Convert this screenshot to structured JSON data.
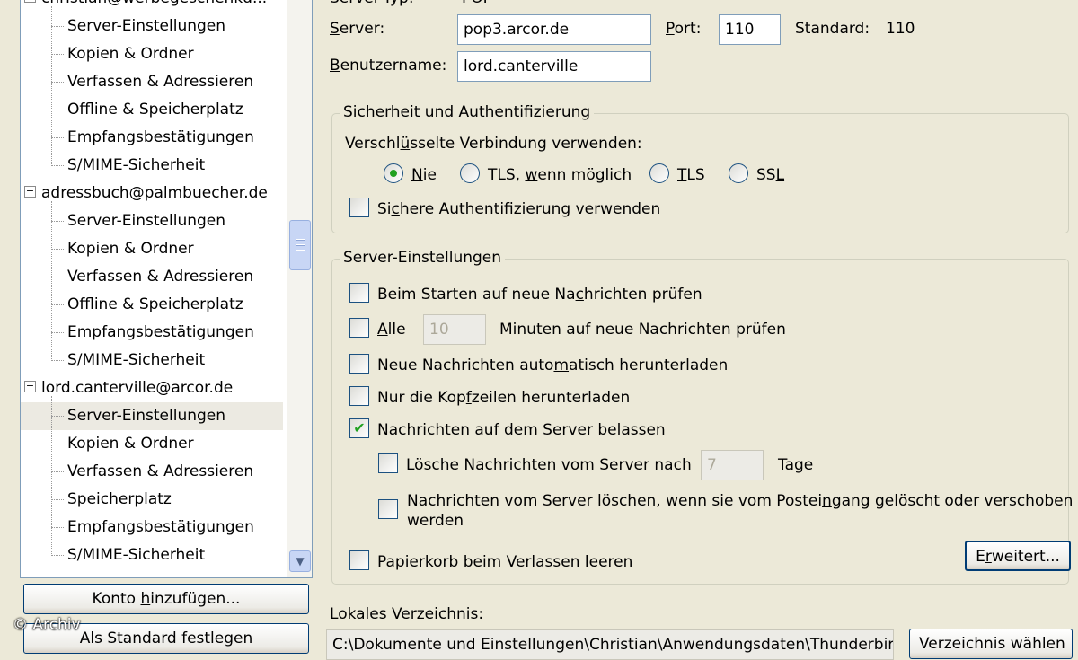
{
  "tree": {
    "items": [
      {
        "label": "christian@werbegeschenkd...",
        "level": 0
      },
      {
        "label": "Server-Einstellungen",
        "level": 1
      },
      {
        "label": "Kopien & Ordner",
        "level": 1
      },
      {
        "label": "Verfassen & Adressieren",
        "level": 1
      },
      {
        "label": "Offline & Speicherplatz",
        "level": 1
      },
      {
        "label": "Empfangsbestätigungen",
        "level": 1
      },
      {
        "label": "S/MIME-Sicherheit",
        "level": 1
      },
      {
        "label": "adressbuch@palmbuecher.de",
        "level": 0
      },
      {
        "label": "Server-Einstellungen",
        "level": 1
      },
      {
        "label": "Kopien & Ordner",
        "level": 1
      },
      {
        "label": "Verfassen & Adressieren",
        "level": 1
      },
      {
        "label": "Offline & Speicherplatz",
        "level": 1
      },
      {
        "label": "Empfangsbestätigungen",
        "level": 1
      },
      {
        "label": "S/MIME-Sicherheit",
        "level": 1
      },
      {
        "label": "lord.canterville@arcor.de",
        "level": 0
      },
      {
        "label": "Server-Einstellungen",
        "level": 1,
        "selected": true
      },
      {
        "label": "Kopien & Ordner",
        "level": 1
      },
      {
        "label": "Verfassen & Adressieren",
        "level": 1
      },
      {
        "label": "Speicherplatz",
        "level": 1
      },
      {
        "label": "Empfangsbestätigungen",
        "level": 1
      },
      {
        "label": "S/MIME-Sicherheit",
        "level": 1
      }
    ],
    "collapse_glyph": "−"
  },
  "buttons": {
    "add_account": {
      "before": "Konto ",
      "key": "h",
      "after": "inzufügen..."
    },
    "set_default": "Als Standard festlegen",
    "advanced": {
      "before": "E",
      "key": "r",
      "after": "weitert..."
    },
    "choose_dir": "Verzeichnis wählen"
  },
  "watermark": "© Archiv",
  "server": {
    "type_label": "Server-Typ:",
    "type_value": "POP",
    "server_label": {
      "key": "S",
      "rest": "erver:"
    },
    "server_value": "pop3.arcor.de",
    "port_label": {
      "key": "P",
      "rest": "ort:"
    },
    "port_value": "110",
    "standard_label": "Standard:",
    "standard_value": "110",
    "user_label": {
      "key": "B",
      "rest": "enutzername:"
    },
    "user_value": "lord.canterville"
  },
  "security": {
    "title": "Sicherheit und Authentifizierung",
    "encryption_label": {
      "before": "Verschl",
      "key": "ü",
      "after": "sselte Verbindung verwenden:"
    },
    "radios": [
      {
        "before": "",
        "key": "N",
        "after": "ie",
        "checked": true
      },
      {
        "before": "TLS, ",
        "key": "w",
        "after": "enn möglich",
        "checked": false
      },
      {
        "before": "",
        "key": "T",
        "after": "LS",
        "checked": false
      },
      {
        "before": "SS",
        "key": "L",
        "after": "",
        "checked": false
      }
    ],
    "secure_auth": {
      "before": "Si",
      "key": "c",
      "after": "here Authentifizierung verwenden",
      "checked": false
    }
  },
  "server_settings": {
    "title": "Server-Einstellungen",
    "check_on_start": {
      "before": "Beim Starten auf neue Na",
      "key": "c",
      "after": "hrichten prüfen",
      "checked": false
    },
    "check_every": {
      "before": "",
      "key": "A",
      "after": "lle",
      "checked": false
    },
    "minutes_value": "10",
    "minutes_label": "Minuten auf neue Nachrichten prüfen",
    "auto_download": {
      "before": "Neue Nachrichten auto",
      "key": "m",
      "after": "atisch herunterladen",
      "checked": false
    },
    "headers_only": {
      "before": "Nur die Kop",
      "key": "f",
      "after": "zeilen herunterladen",
      "checked": false
    },
    "leave_on_server": {
      "before": "Nachrichten auf dem Server ",
      "key": "b",
      "after": "elassen",
      "checked": true
    },
    "delete_after": {
      "before": "Lösche Nachrichten vo",
      "key": "m",
      "after": " Server nach",
      "checked": false
    },
    "days_value": "7",
    "days_label": "Tage",
    "delete_when_removed": {
      "line1_before": "Nachrichten vom Server löschen, wenn sie vom Postei",
      "key": "n",
      "line1_after": "gang gelöscht oder verschoben",
      "line2": "werden",
      "checked": false
    },
    "empty_trash": {
      "before": "Papierkorb beim ",
      "key": "V",
      "after": "erlassen leeren",
      "checked": false
    }
  },
  "local_dir": {
    "label": {
      "key": "L",
      "rest": "okales Verzeichnis:"
    },
    "value": "C:\\Dokumente und Einstellungen\\Christian\\Anwendungsdaten\\Thunderbird"
  }
}
